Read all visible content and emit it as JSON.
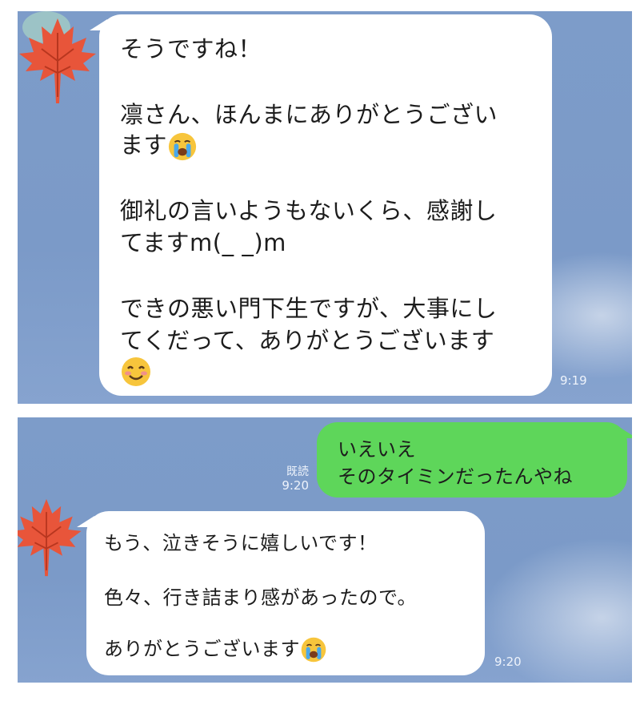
{
  "top": {
    "message": {
      "lines": [
        "そうですね！",
        "凛さん、ほんまにありがとうござい",
        "ます",
        "御礼の言いようもないくら、感謝し",
        "てますm(_ _)m",
        "できの悪い門下生ですが、大事にし",
        "てくだって、ありがとうございます"
      ],
      "emoji": [
        "crying-face",
        "smiling-face"
      ],
      "time": "9:19"
    }
  },
  "bottom": {
    "sent": {
      "lines": [
        "いえいえ",
        "そのタイミンだったんやね"
      ],
      "read_label": "既読",
      "time": "9:20"
    },
    "received": {
      "lines": [
        "もう、泣きそうに嬉しいです！",
        "色々、行き詰まり感があったので。",
        "ありがとうございます"
      ],
      "emoji": [
        "crying-face"
      ],
      "time": "9:20"
    }
  },
  "colors": {
    "chat_background": "#7d9cc9",
    "received_bubble": "#ffffff",
    "sent_bubble": "#5ed65a",
    "avatar_leaf": "#e8553a"
  },
  "icons": [
    "maple-leaf-avatar-icon",
    "crying-face-emoji-icon",
    "smiling-face-emoji-icon"
  ]
}
